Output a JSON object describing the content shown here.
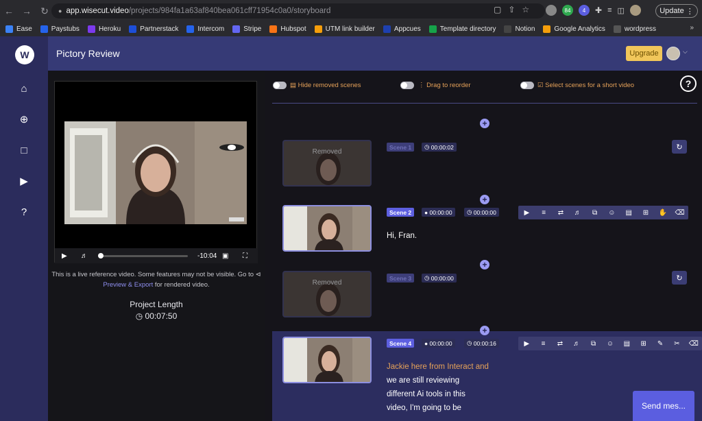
{
  "browser": {
    "url_host": "app.wisecut.video",
    "url_path": "/projects/984fa1a63af840bea061cff71954c0a0/storyboard",
    "update_label": "Update",
    "bookmarks": [
      {
        "label": "Ease",
        "color": "#3b82f6"
      },
      {
        "label": "Paystubs",
        "color": "#2563eb"
      },
      {
        "label": "Heroku",
        "color": "#7c3aed"
      },
      {
        "label": "Partnerstack",
        "color": "#1d4ed8"
      },
      {
        "label": "Intercom",
        "color": "#2563eb"
      },
      {
        "label": "Stripe",
        "color": "#6366f1"
      },
      {
        "label": "Hubspot",
        "color": "#f97316"
      },
      {
        "label": "UTM link builder",
        "color": "#f59e0b"
      },
      {
        "label": "Appcues",
        "color": "#1e40af"
      },
      {
        "label": "Template directory",
        "color": "#16a34a"
      },
      {
        "label": "Notion",
        "color": "#444444"
      },
      {
        "label": "Google Analytics",
        "color": "#f59e0b"
      },
      {
        "label": "wordpress",
        "color": "#555555"
      }
    ],
    "ext_badges": [
      "",
      "84",
      "4"
    ]
  },
  "app": {
    "logo": "W",
    "title": "Pictory Review",
    "upgrade_label": "Upgrade"
  },
  "player": {
    "time_remaining": "-10:04",
    "note_line1": "This is a live reference video. Some features may not be visible. Go to",
    "note_link": "Preview & Export",
    "note_line2": " for rendered video.",
    "project_length_label": "Project Length",
    "project_length": "00:07:50"
  },
  "options": {
    "hide_removed": "Hide removed scenes",
    "drag_reorder": "Drag to reorder",
    "select_short": "Select scenes for a short video"
  },
  "scenes": [
    {
      "badge": "Scene 1",
      "removed_label": "Removed",
      "duration": "00:00:02"
    },
    {
      "badge": "Scene 2",
      "start": "00:00:00",
      "duration": "00:00:00",
      "text": "Hi, Fran."
    },
    {
      "badge": "Scene 3",
      "removed_label": "Removed",
      "duration": "00:00:00"
    },
    {
      "badge": "Scene 4",
      "start": "00:00:00",
      "duration": "00:00:16",
      "text_highlight": "Jackie here from Interact and",
      "text_lines": [
        "we are still reviewing",
        "different Ai tools in this",
        "video, I'm going to be"
      ]
    }
  ],
  "send_label": "Send mes..."
}
